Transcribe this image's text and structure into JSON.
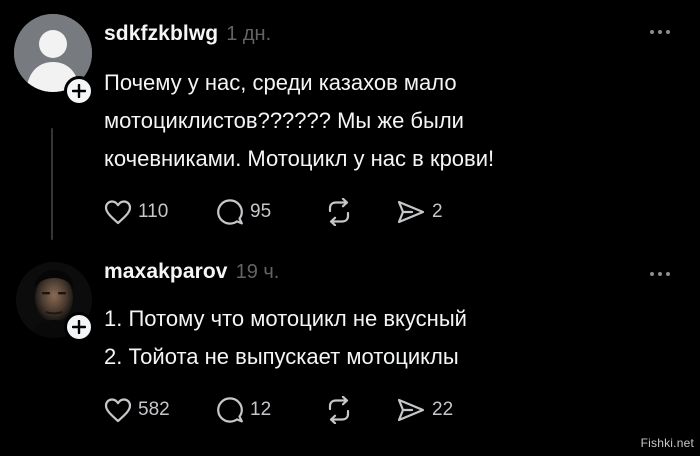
{
  "posts": [
    {
      "username": "sdkfzkblwg",
      "timestamp": "1 дн.",
      "text_lines": [
        "Почему у нас, среди казахов мало",
        "мотоциклистов?????? Мы же были",
        "кочевниками. Мотоцикл у нас в крови!"
      ],
      "likes": "110",
      "replies": "95",
      "shares": "2",
      "avatar_icon": "default-person-avatar"
    },
    {
      "username": "maxakparov",
      "timestamp": "19 ч.",
      "text_lines": [
        "1. Потому что мотоцикл не вкусный",
        "2. Тойота не выпускает мотоциклы"
      ],
      "likes": "582",
      "replies": "12",
      "shares": "22",
      "avatar_icon": "user-photo-avatar"
    }
  ],
  "icons": {
    "like": "heart-icon",
    "reply": "comment-bubble-icon",
    "repost": "repost-arrows-icon",
    "share": "send-paper-plane-icon",
    "more": "more-dots-icon",
    "follow": "plus-icon"
  },
  "watermark": "Fishki.net"
}
